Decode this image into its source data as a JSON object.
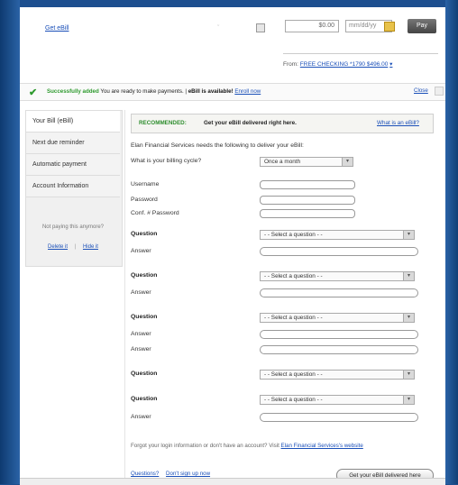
{
  "top": {
    "get_ebill": "Get eBill",
    "amount_placeholder": "$0.00",
    "date_placeholder": "mm/dd/yy",
    "pay_label": "Pay",
    "from_label": "From:",
    "from_account": "FREE CHECKING *1790 $496.00"
  },
  "banner": {
    "success": "Successfully added",
    "message": "You are ready to make payments.",
    "available": "eBill is available!",
    "enroll": "Enroll now",
    "close": "Close"
  },
  "nav": {
    "items": [
      {
        "label": "Your Bill (eBill)"
      },
      {
        "label": "Next due reminder"
      },
      {
        "label": "Automatic payment"
      },
      {
        "label": "Account Information"
      }
    ],
    "question": "Not paying this anymore?",
    "delete": "Delete it",
    "hide": "Hide it"
  },
  "rec": {
    "label": "RECOMMENDED:",
    "text": "Get your eBill delivered right here.",
    "what": "What is an eBill?"
  },
  "form": {
    "intro": "Elan Financial Services needs the following to deliver your eBill:",
    "billing_label": "What is your billing cycle?",
    "billing_value": "Once a month",
    "username": "Username",
    "password": "Password",
    "confirm": "Conf. # Password",
    "question_label": "Question",
    "answer_label": "Answer",
    "select_placeholder": "- - Select a question - -",
    "forgot": "Forgot your login information or don't have an account? Visit",
    "forgot_link": "Elan Financial Services's website",
    "questions_link": "Questions?",
    "dont_sign_up": "Don't sign up now",
    "submit": "Get your eBill delivered here"
  }
}
